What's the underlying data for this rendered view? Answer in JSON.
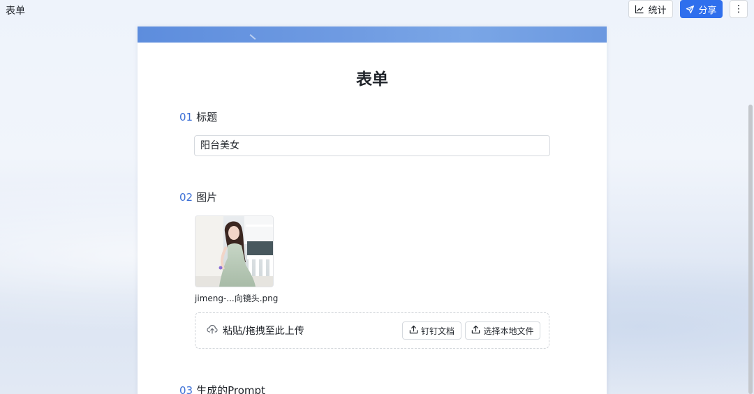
{
  "header": {
    "title": "表单",
    "stats_label": "统计",
    "share_label": "分享",
    "more_label": "⋮"
  },
  "form": {
    "title": "表单",
    "questions": [
      {
        "number": "01",
        "label": "标题",
        "value": "阳台美女"
      },
      {
        "number": "02",
        "label": "图片",
        "file_name": "jimeng-...向镜头.png"
      },
      {
        "number": "03",
        "label": "生成的Prompt"
      }
    ],
    "upload": {
      "hint": "粘贴/拖拽至此上传",
      "dingtalk_label": "钉钉文档",
      "local_label": "选择本地文件"
    }
  },
  "icons": {
    "stats": "line-chart-icon",
    "share": "send-icon",
    "more": "more-vertical-icon",
    "cloud_upload": "cloud-upload-icon",
    "upload": "upload-icon"
  },
  "colors": {
    "primary": "#2f6fed",
    "question_number": "#3b6fd6",
    "banner": "#6f9be2"
  }
}
